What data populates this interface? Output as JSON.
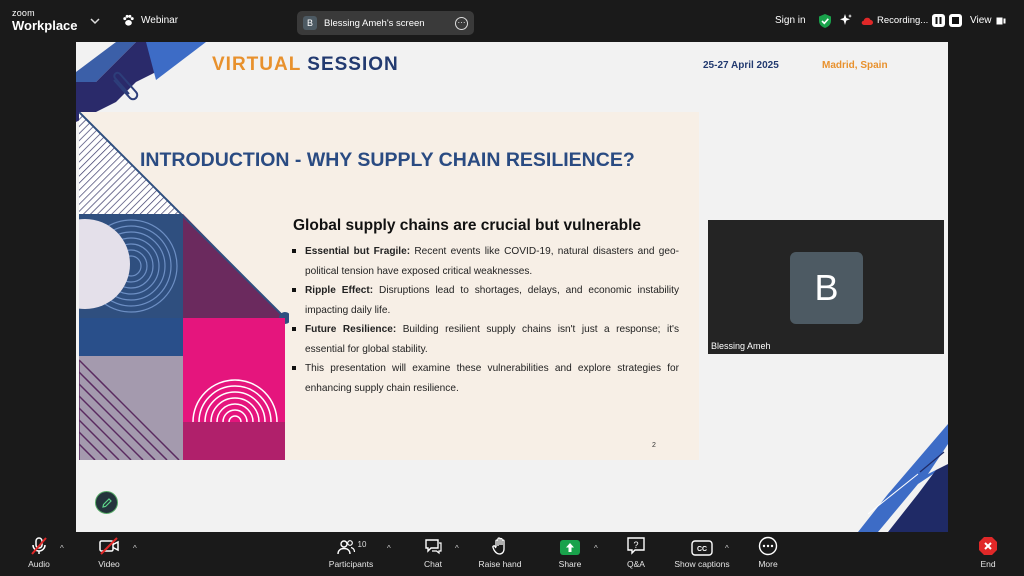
{
  "app": {
    "brand_small": "zoom",
    "brand_big": "Workplace",
    "mode_label": "Webinar"
  },
  "screen_share": {
    "initial": "B",
    "label": "Blessing Ameh's screen"
  },
  "topbar": {
    "sign_in": "Sign in",
    "recording_label": "Recording...",
    "view_label": "View"
  },
  "slide": {
    "header_word1": "VIRTUAL",
    "header_word2": "SESSION",
    "dates": "25-27 April 2025",
    "location": "Madrid, Spain",
    "title": "INTRODUCTION - WHY SUPPLY CHAIN RESILIENCE?",
    "subtitle": "Global supply chains are crucial but vulnerable",
    "bullets": [
      {
        "bold": "Essential but Fragile:",
        "text": " Recent events like COVID-19, natural disasters and geo-political tension have exposed critical weaknesses."
      },
      {
        "bold": "Ripple Effect:",
        "text": " Disruptions lead to shortages, delays, and economic instability impacting daily life."
      },
      {
        "bold": "Future Resilience:",
        "text": " Building resilient supply chains isn't just a response; it's essential for global stability."
      },
      {
        "bold": "",
        "text": "This presentation will examine these vulnerabilities and explore strategies for enhancing supply chain resilience."
      }
    ],
    "page_number": "2"
  },
  "participant": {
    "initial": "B",
    "name": "Blessing Ameh"
  },
  "toolbar": {
    "audio": "Audio",
    "video": "Video",
    "participants": "Participants",
    "participants_count": "10",
    "chat": "Chat",
    "raise_hand": "Raise hand",
    "share": "Share",
    "qa": "Q&A",
    "captions": "Show captions",
    "more": "More",
    "end": "End"
  },
  "colors": {
    "accent_green": "#19a24b",
    "end_red": "#e02828",
    "navy": "#223a70",
    "orange": "#e8912d",
    "slide_title": "#2a4b82"
  }
}
